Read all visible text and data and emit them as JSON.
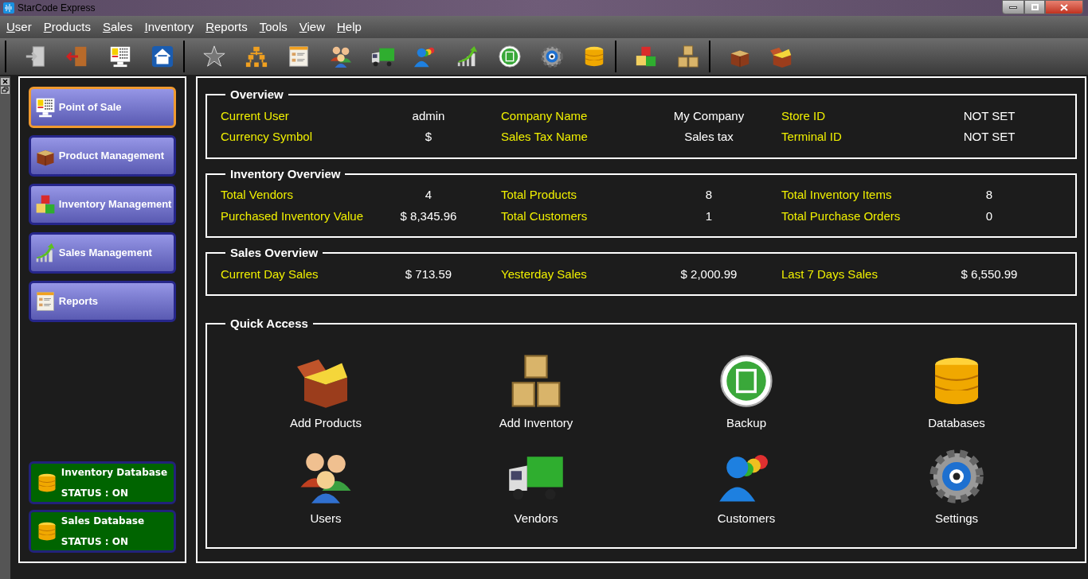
{
  "window": {
    "title": "StarCode Express"
  },
  "menu": [
    {
      "label": "User"
    },
    {
      "label": "Products"
    },
    {
      "label": "Sales"
    },
    {
      "label": "Inventory"
    },
    {
      "label": "Reports"
    },
    {
      "label": "Tools"
    },
    {
      "label": "View"
    },
    {
      "label": "Help"
    }
  ],
  "sidebar": {
    "items": [
      {
        "label": "Point of Sale",
        "selected": true
      },
      {
        "label": "Product Management",
        "selected": false
      },
      {
        "label": "Inventory Management",
        "selected": false
      },
      {
        "label": "Sales Management",
        "selected": false
      },
      {
        "label": "Reports",
        "selected": false
      }
    ],
    "databases": [
      {
        "name": "Inventory Database",
        "status": "STATUS : ON",
        "on": true
      },
      {
        "name": "Sales Database",
        "status": "STATUS : ON",
        "on": true
      }
    ]
  },
  "sections": [
    {
      "title": "Overview",
      "rows": [
        [
          {
            "label": "Current User",
            "value": "admin"
          },
          {
            "label": "Company Name",
            "value": "My Company"
          },
          {
            "label": "Store ID",
            "value": "NOT SET"
          }
        ],
        [
          {
            "label": "Currency Symbol",
            "value": "$"
          },
          {
            "label": "Sales Tax Name",
            "value": "Sales tax"
          },
          {
            "label": "Terminal ID",
            "value": "NOT SET"
          }
        ]
      ]
    },
    {
      "title": "Inventory Overview",
      "rows": [
        [
          {
            "label": "Total Vendors",
            "value": "4"
          },
          {
            "label": "Total Products",
            "value": "8"
          },
          {
            "label": "Total Inventory Items",
            "value": "8"
          }
        ],
        [
          {
            "label": "Purchased Inventory Value",
            "value": "$ 8,345.96"
          },
          {
            "label": "Total Customers",
            "value": "1"
          },
          {
            "label": "Total Purchase Orders",
            "value": "0"
          }
        ]
      ]
    },
    {
      "title": "Sales Overview",
      "rows": [
        [
          {
            "label": "Current Day Sales",
            "value": "$ 713.59"
          },
          {
            "label": "Yesterday Sales",
            "value": "$ 2,000.99"
          },
          {
            "label": "Last 7 Days Sales",
            "value": "$ 6,550.99"
          }
        ]
      ]
    }
  ],
  "quick_access": {
    "title": "Quick Access",
    "items": [
      {
        "label": "Add Products"
      },
      {
        "label": "Add Inventory"
      },
      {
        "label": "Backup"
      },
      {
        "label": "Databases"
      },
      {
        "label": "Users"
      },
      {
        "label": "Vendors"
      },
      {
        "label": "Customers"
      },
      {
        "label": "Settings"
      }
    ]
  }
}
